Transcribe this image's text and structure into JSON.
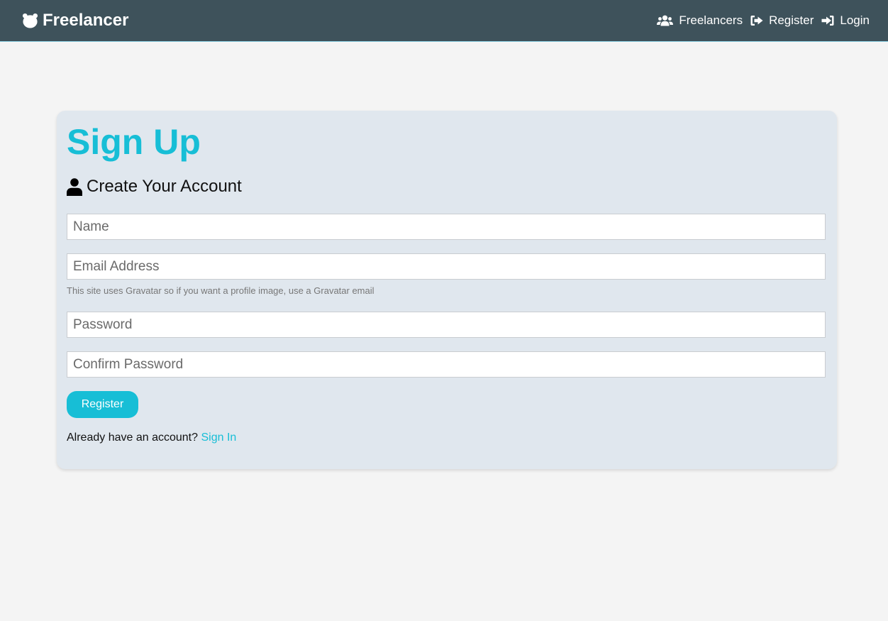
{
  "navbar": {
    "brand": "Freelancer",
    "brand_icon": "bear-icon",
    "links": [
      {
        "label": "Freelancers",
        "icon": "users-icon"
      },
      {
        "label": "Register",
        "icon": "sign-out-icon"
      },
      {
        "label": "Login",
        "icon": "sign-in-icon"
      }
    ]
  },
  "form": {
    "title": "Sign Up",
    "subtitle": "Create Your Account",
    "subtitle_icon": "user-icon",
    "fields": {
      "name": {
        "placeholder": "Name",
        "value": ""
      },
      "email": {
        "placeholder": "Email Address",
        "value": ""
      },
      "password": {
        "placeholder": "Password",
        "value": ""
      },
      "confirm_password": {
        "placeholder": "Confirm Password",
        "value": ""
      }
    },
    "email_hint": "This site uses Gravatar so if you want a profile image, use a Gravatar email",
    "submit_label": "Register",
    "footer_text": "Already have an account?",
    "footer_link": "Sign In"
  },
  "colors": {
    "navbar_bg": "#3e525b",
    "accent": "#17bed6",
    "card_bg": "#e0e7ee",
    "page_bg": "#f4f4f4"
  }
}
